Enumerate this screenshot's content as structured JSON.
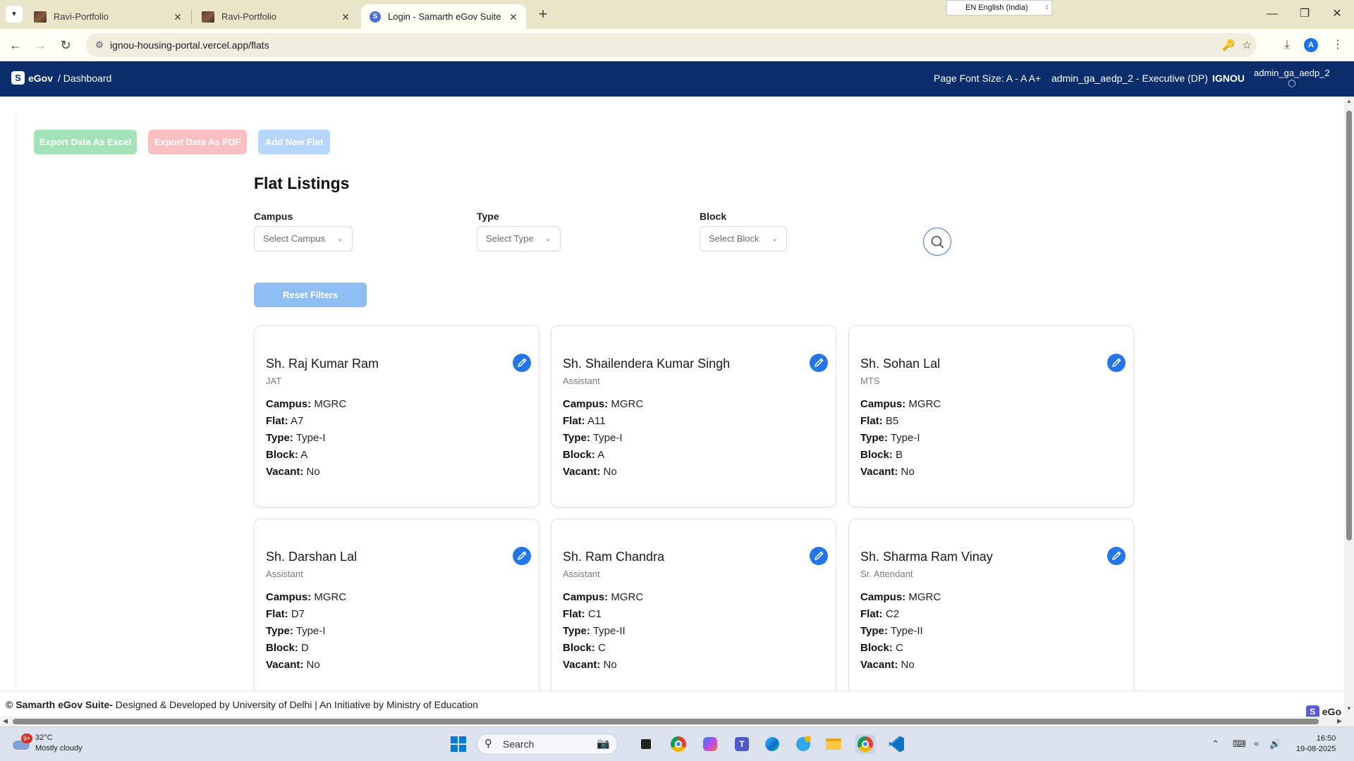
{
  "browser": {
    "tabs": [
      {
        "title": "Ravi-Portfolio",
        "favicon": "portfolio-favicon",
        "active": false
      },
      {
        "title": "Ravi-Portfolio",
        "favicon": "portfolio-favicon",
        "active": false
      },
      {
        "title": "Login - Samarth eGov Suite",
        "favicon": "samarth-favicon",
        "active": true
      }
    ],
    "language_indicator": "EN English (India)",
    "url": "ignou-housing-portal.vercel.app/flats"
  },
  "header": {
    "brand_logo_letter": "S",
    "brand": "eGov",
    "breadcrumb": "/ Dashboard",
    "font_size_label": "Page Font Size: A - A A+",
    "role": "admin_ga_aedp_2 - Executive (DP)",
    "org": "IGNOU",
    "username": "admin_ga_aedp_2"
  },
  "actions": {
    "export_excel": "Export Data As Excel",
    "export_pdf": "Export Data As PDF",
    "add_flat": "Add New Flat"
  },
  "page": {
    "title": "Flat Listings"
  },
  "filters": {
    "campus": {
      "label": "Campus",
      "placeholder": "Select Campus"
    },
    "type": {
      "label": "Type",
      "placeholder": "Select Type"
    },
    "block": {
      "label": "Block",
      "placeholder": "Select Block"
    },
    "reset": "Reset Filters"
  },
  "field_labels": {
    "campus": "Campus:",
    "flat": "Flat:",
    "type": "Type:",
    "block": "Block:",
    "vacant": "Vacant:"
  },
  "flats": [
    {
      "name": "Sh. Raj Kumar Ram",
      "designation": "JAT",
      "campus": "MGRC",
      "flat": "A7",
      "type": "Type-I",
      "block": "A",
      "vacant": "No"
    },
    {
      "name": "Sh. Shailendera Kumar Singh",
      "designation": "Assistant",
      "campus": "MGRC",
      "flat": "A11",
      "type": "Type-I",
      "block": "A",
      "vacant": "No"
    },
    {
      "name": "Sh. Sohan Lal",
      "designation": "MTS",
      "campus": "MGRC",
      "flat": "B5",
      "type": "Type-I",
      "block": "B",
      "vacant": "No"
    },
    {
      "name": "Sh. Darshan Lal",
      "designation": "Assistant",
      "campus": "MGRC",
      "flat": "D7",
      "type": "Type-I",
      "block": "D",
      "vacant": "No"
    },
    {
      "name": "Sh. Ram Chandra",
      "designation": "Assistant",
      "campus": "MGRC",
      "flat": "C1",
      "type": "Type-II",
      "block": "C",
      "vacant": "No"
    },
    {
      "name": "Sh. Sharma Ram Vinay",
      "designation": "Sr. Attendant",
      "campus": "MGRC",
      "flat": "C2",
      "type": "Type-II",
      "block": "C",
      "vacant": "No"
    }
  ],
  "footer": {
    "brand": "© Samarth eGov Suite-",
    "text": " Designed & Developed by University of Delhi | An Initiative by Ministry of Education",
    "badge_letter": "S",
    "badge": "eGo"
  },
  "taskbar": {
    "notification_count": "9+",
    "temperature": "32°C",
    "weather": "Mostly cloudy",
    "search_placeholder": "Search",
    "profile_letter": "A",
    "time": "16:50",
    "date": "19-08-2025"
  },
  "colors": {
    "header_bg": "#0b2d6b",
    "accent_blue": "#2476e8",
    "excel_btn": "#a4e2b8",
    "pdf_btn": "#f9bfc3",
    "add_btn": "#b7d6fb",
    "reset_btn": "#8fbef5"
  }
}
